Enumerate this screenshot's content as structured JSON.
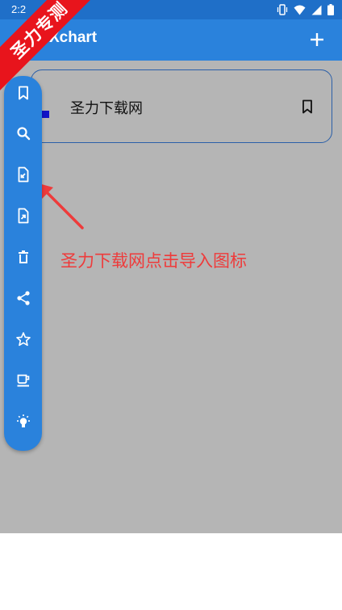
{
  "status_bar": {
    "time": "2:2",
    "icons": [
      "vibrate-icon",
      "wifi-icon",
      "signal-icon",
      "battery-icon"
    ]
  },
  "app_bar": {
    "title": "Xchart",
    "action_icon": "add-icon"
  },
  "card": {
    "title": "圣力下载网",
    "action_icon": "bookmark-icon"
  },
  "sidebar": {
    "items": [
      {
        "name": "bookmark",
        "icon": "bookmark-icon"
      },
      {
        "name": "search",
        "icon": "search-icon"
      },
      {
        "name": "import",
        "icon": "file-import-icon"
      },
      {
        "name": "export",
        "icon": "file-export-icon"
      },
      {
        "name": "delete",
        "icon": "trash-icon"
      },
      {
        "name": "share",
        "icon": "share-icon"
      },
      {
        "name": "favorite",
        "icon": "star-icon"
      },
      {
        "name": "donate",
        "icon": "coffee-icon"
      },
      {
        "name": "tips",
        "icon": "bulb-icon"
      }
    ]
  },
  "annotation": {
    "text": "圣力下载网点击导入图标"
  },
  "watermark": {
    "text": "圣力专测"
  },
  "colors": {
    "app_bar": "#2a82dc",
    "status_bar": "#1f6fc8",
    "scrim": "#b5b5b5",
    "annotation": "#ee3b3b",
    "ribbon": "#e8141c"
  }
}
